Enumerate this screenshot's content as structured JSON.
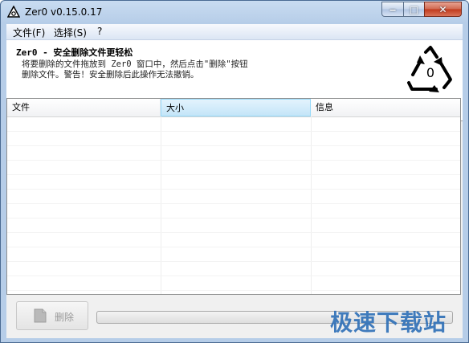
{
  "window": {
    "title": "Zer0 v0.15.0.17"
  },
  "caption_buttons": {
    "minimize": "‒",
    "maximize": "□",
    "close": "✕"
  },
  "menu": [
    {
      "label": "文件(F)"
    },
    {
      "label": "选择(S)"
    },
    {
      "label": "?"
    }
  ],
  "banner": {
    "title": "Zer0 - 安全删除文件更轻松",
    "description": "将要删除的文件拖放到 Zer0 窗口中，然后点击\"删除\"按钮\n删除文件。警告！安全删除后此操作无法撤销。",
    "logo_digit": "0"
  },
  "list": {
    "columns": [
      {
        "label": "文件"
      },
      {
        "label": "大小",
        "sorted": true
      },
      {
        "label": "信息"
      }
    ],
    "rows": []
  },
  "actions": {
    "delete_label": "删除",
    "delete_enabled": false
  },
  "progress": {
    "value": 0
  },
  "watermark": "极速下载站"
}
